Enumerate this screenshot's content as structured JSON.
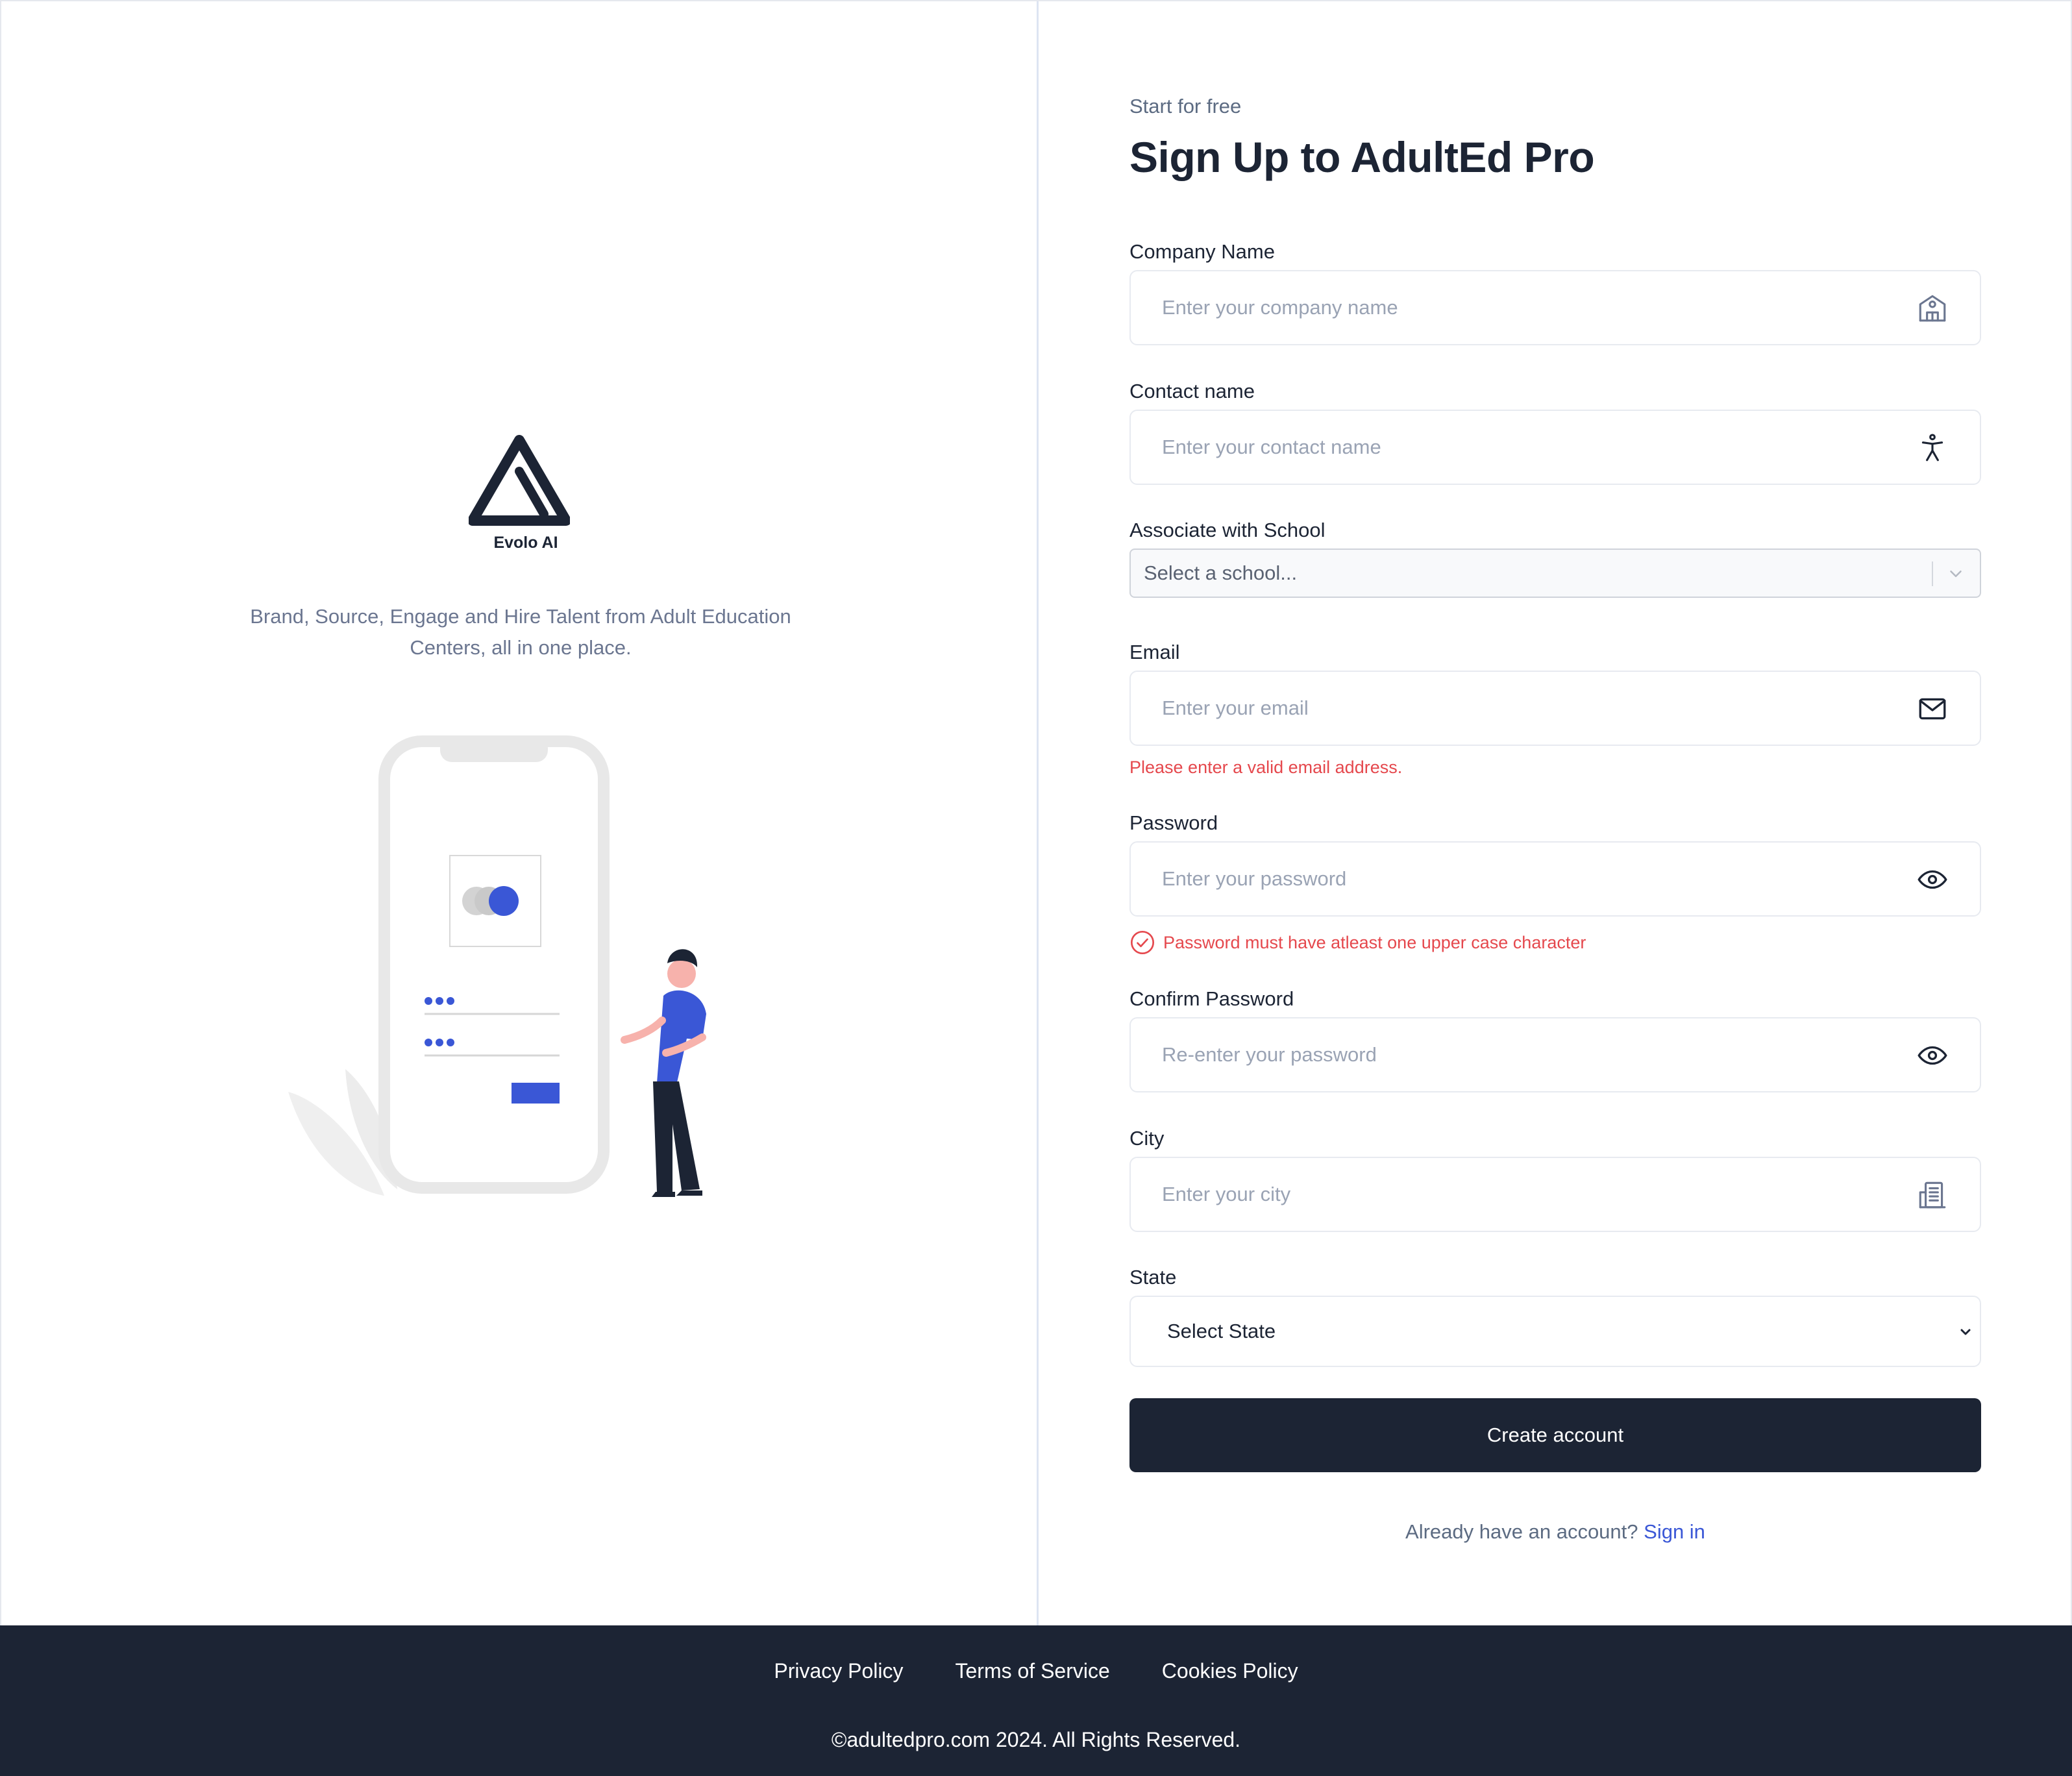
{
  "left_panel": {
    "brand": "Evolo AI",
    "tagline_line1": "Brand, Source, Engage and Hire Talent from Adult Education",
    "tagline_line2": "Centers, all in one place."
  },
  "form": {
    "eyebrow": "Start for free",
    "title": "Sign Up to AdultEd Pro",
    "company": {
      "label": "Company Name",
      "placeholder": "Enter your company name",
      "icon": "building-icon"
    },
    "contact": {
      "label": "Contact name",
      "placeholder": "Enter your contact name",
      "icon": "person-icon"
    },
    "school": {
      "label": "Associate with School",
      "placeholder": "Select a school...",
      "icon": "chevron-down-icon"
    },
    "email": {
      "label": "Email",
      "placeholder": "Enter your email",
      "icon": "envelope-icon",
      "error": "Please enter a valid email address."
    },
    "password": {
      "label": "Password",
      "placeholder": "Enter your password",
      "icon": "eye-icon",
      "error": "Password must have atleast one upper case character"
    },
    "confirm": {
      "label": "Confirm Password",
      "placeholder": "Re-enter your password",
      "icon": "eye-icon"
    },
    "city": {
      "label": "City",
      "placeholder": "Enter your city",
      "icon": "office-building-icon"
    },
    "state": {
      "label": "State",
      "value": "Select State"
    },
    "submit_label": "Create account",
    "signin_prompt": "Already have an account?",
    "signin_link": "Sign in"
  },
  "footer": {
    "links": [
      "Privacy Policy",
      "Terms of Service",
      "Cookies Policy"
    ],
    "copyright": "©adultedpro.com 2024. All Rights Reserved."
  },
  "colors": {
    "primary_dark": "#1c2434",
    "accent_blue": "#3a57d6",
    "error_red": "#e5484d"
  }
}
